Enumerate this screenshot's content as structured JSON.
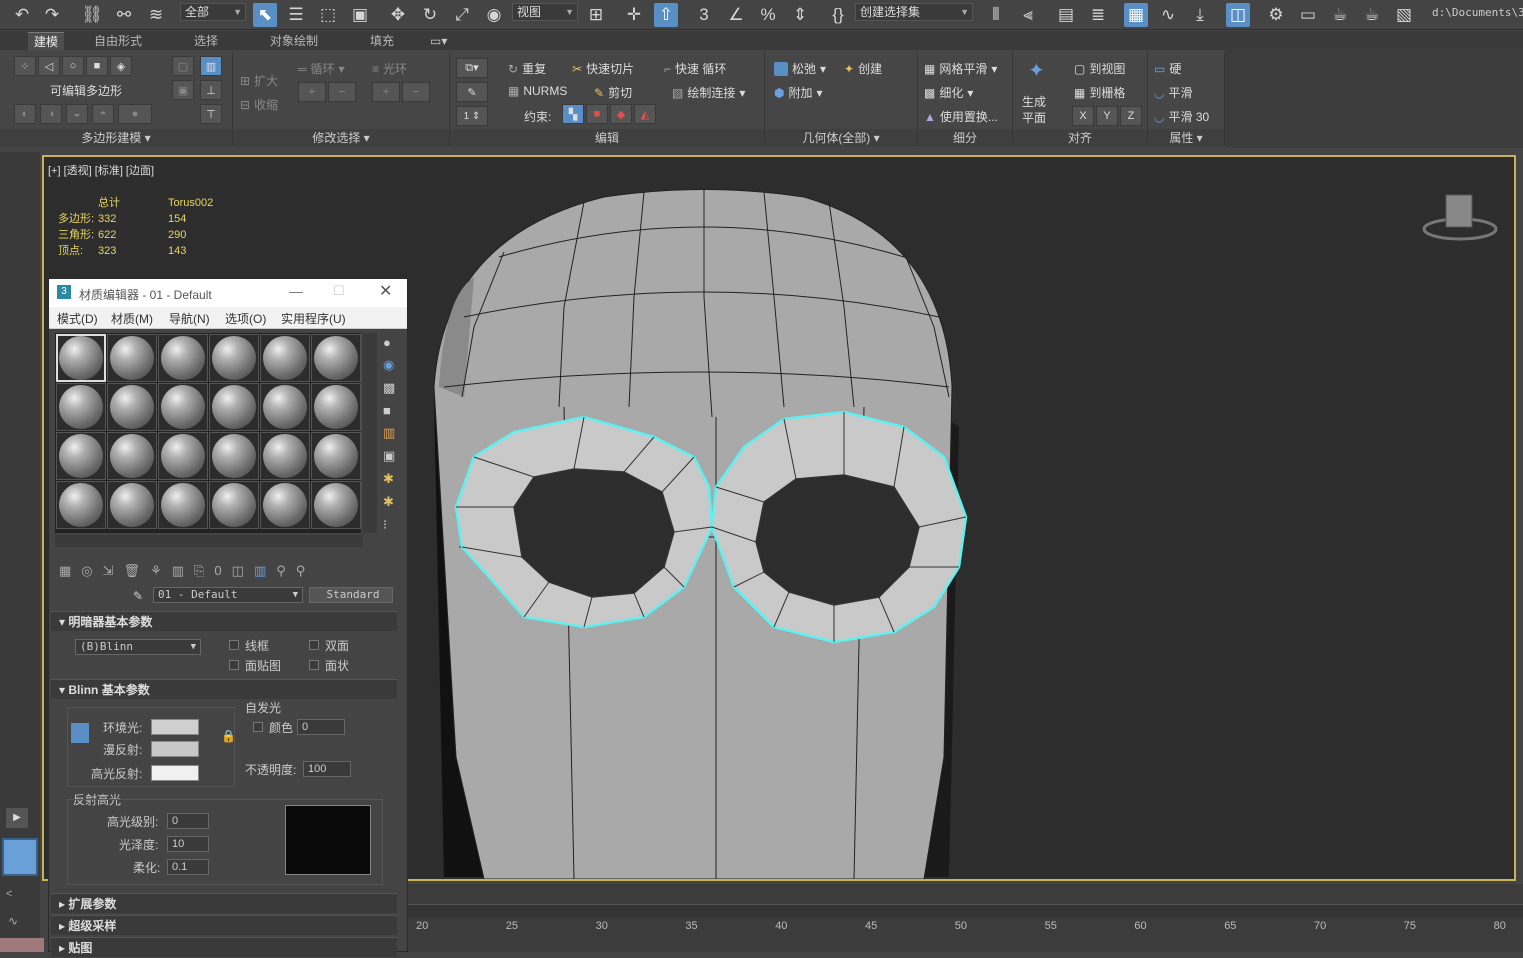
{
  "toolbar": {
    "selection_filter": "全部",
    "ref_coord": "视图",
    "named_selection": "创建选择集",
    "path": "d:\\Documents\\3"
  },
  "ribbon": {
    "tabs": [
      "建模",
      "自由形式",
      "选择",
      "对象绘制",
      "填充"
    ],
    "poly_modeling": {
      "label": "可编辑多边形",
      "panel": "多边形建模"
    },
    "modify_selection": {
      "grow": "扩大",
      "shrink": "收缩",
      "loop": "循环",
      "ring": "光环",
      "panel": "修改选择"
    },
    "edit": {
      "repeat": "重复",
      "quickslice": "快速切片",
      "swiftloop": "快速 循环",
      "nurms": "NURMS",
      "cut": "剪切",
      "paintconnect": "绘制连接",
      "constraints": "约束:",
      "panel": "编辑"
    },
    "geometry": {
      "relax": "松弛",
      "create": "创建",
      "attach": "附加",
      "panel": "几何体(全部)"
    },
    "subdivision": {
      "meshsmooth": "网格平滑",
      "tessellate": "细化",
      "usedisplace": "使用置换...",
      "panel": "细分"
    },
    "align": {
      "make_planar": "生成\n平面",
      "to_view": "到视图",
      "to_grid": "到栅格",
      "x": "X",
      "y": "Y",
      "z": "Z",
      "panel": "对齐"
    },
    "properties": {
      "hard": "硬",
      "smooth": "平滑",
      "smooth30": "平滑 30",
      "panel": "属性"
    }
  },
  "viewport": {
    "label": "[+] [透视] [标准] [边面]",
    "stats": {
      "h_total": "总计",
      "h_obj": "Torus002",
      "rows": [
        {
          "k": "多边形:",
          "t": "332",
          "o": "154"
        },
        {
          "k": "三角形:",
          "t": "622",
          "o": "290"
        },
        {
          "k": "顶点:",
          "t": "323",
          "o": "143"
        }
      ]
    }
  },
  "material_editor": {
    "title": "材质编辑器 - 01 - Default",
    "menu": [
      "模式(D)",
      "材质(M)",
      "导航(N)",
      "选项(O)",
      "实用程序(U)"
    ],
    "mat_name": "01 - Default",
    "mat_type": "Standard",
    "shader": {
      "header": "明暗器基本参数",
      "type": "(B)Blinn",
      "wire": "线框",
      "two_sided": "双面",
      "face_map": "面贴图",
      "faceted": "面状"
    },
    "blinn": {
      "header": "Blinn 基本参数",
      "ambient": "环境光:",
      "diffuse": "漫反射:",
      "specular": "高光反射:",
      "self_illum": "自发光",
      "color": "颜色",
      "self_illum_val": "0",
      "opacity": "不透明度:",
      "opacity_val": "100",
      "spec_hl": "反射高光",
      "spec_level": "高光级别:",
      "spec_level_val": "0",
      "gloss": "光泽度:",
      "gloss_val": "10",
      "soften": "柔化:",
      "soften_val": "0.1"
    },
    "rollouts": [
      "扩展参数",
      "超级采样",
      "贴图"
    ]
  },
  "timeline": {
    "ticks": [
      "20",
      "25",
      "30",
      "35",
      "40",
      "45",
      "50",
      "55",
      "60",
      "65",
      "70",
      "75",
      "80"
    ]
  },
  "colors": {
    "accent": "#5a8fc6",
    "viewport_border": "#c8b35a",
    "selection": "#5ff0f0",
    "stats": "#e8d65c"
  }
}
